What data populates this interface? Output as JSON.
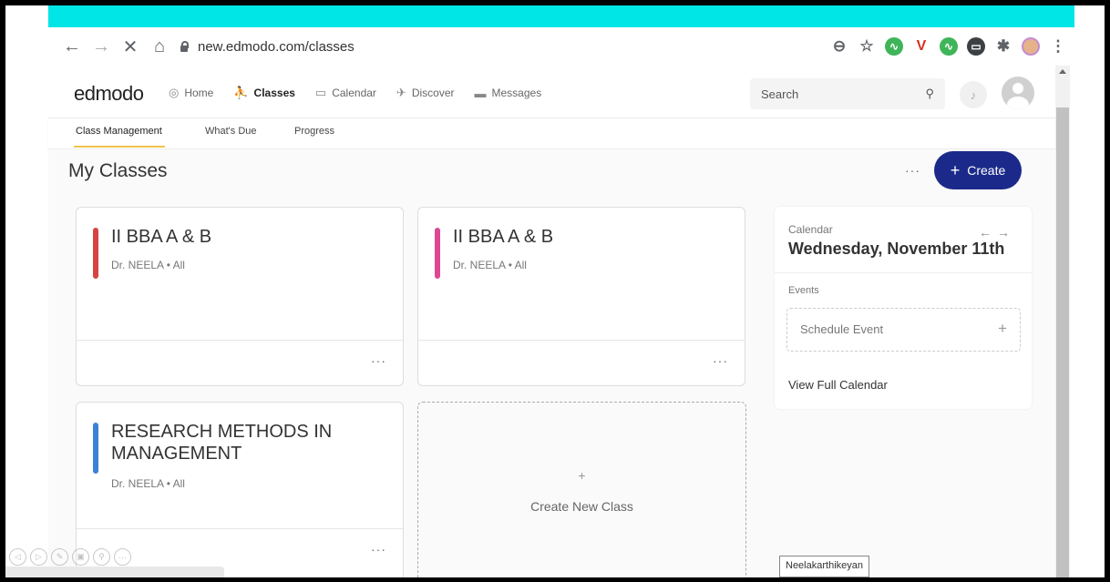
{
  "browser": {
    "url": "new.edmodo.com/classes",
    "nav_icons": [
      "back-icon",
      "forward-icon",
      "close-icon",
      "home-icon"
    ],
    "extensions": [
      "zoom-icon",
      "star-icon",
      "extension-green-icon",
      "extension-v-icon",
      "extension-green-icon",
      "extension-dark-icon",
      "puzzle-icon",
      "profile-avatar",
      "kebab-menu-icon"
    ]
  },
  "app": {
    "logo": "edmodo",
    "nav": [
      {
        "label": "Home",
        "icon": "home-icon"
      },
      {
        "label": "Classes",
        "icon": "classes-icon"
      },
      {
        "label": "Calendar",
        "icon": "calendar-icon"
      },
      {
        "label": "Discover",
        "icon": "discover-icon"
      },
      {
        "label": "Messages",
        "icon": "messages-icon"
      }
    ],
    "search_placeholder": "Search"
  },
  "subtabs": [
    "Class Management",
    "What's Due",
    "Progress"
  ],
  "main": {
    "title": "My Classes",
    "create_label": "Create",
    "classes": [
      {
        "name": "II BBA A & B",
        "meta": "Dr. NEELA • All",
        "color": "#d64541"
      },
      {
        "name": "II BBA A & B",
        "meta": "Dr. NEELA • All",
        "color": "#de4794"
      },
      {
        "name": "RESEARCH METHODS IN MANAGEMENT",
        "meta": "Dr. NEELA • All",
        "color": "#3b82d6"
      }
    ],
    "new_class_label": "Create New Class"
  },
  "calendar": {
    "label": "Calendar",
    "date": "Wednesday, November 11th",
    "events_label": "Events",
    "schedule_label": "Schedule Event",
    "full_label": "View Full Calendar"
  },
  "tooltip": "Neelakarthikeyan",
  "colors": {
    "accent": "#1b2a8a",
    "cyan_strip": "#00e5e5",
    "tab_underline": "#f2c24b"
  }
}
